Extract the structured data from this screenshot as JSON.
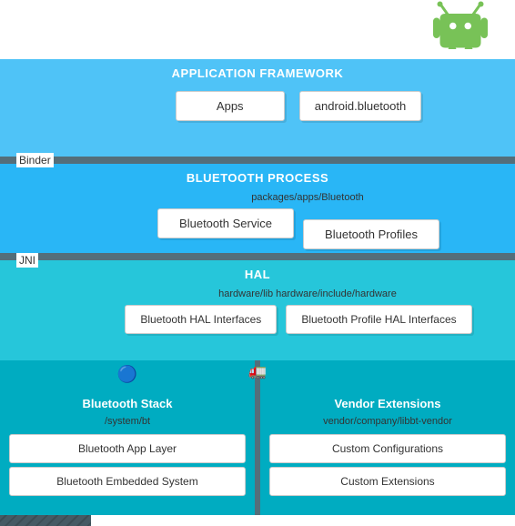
{
  "android_logo": {
    "alt": "Android Logo"
  },
  "layers": {
    "app_framework": {
      "header": "APPLICATION FRAMEWORK",
      "boxes": [
        "Apps",
        "android.bluetooth"
      ]
    },
    "binder_label": "Binder",
    "bt_process": {
      "header": "BLUETOOTH PROCESS",
      "sub_label": "packages/apps/Bluetooth",
      "boxes": [
        "Bluetooth Service",
        "Bluetooth Profiles"
      ]
    },
    "jni_label": "JNI",
    "hal": {
      "header": "HAL",
      "sub_label": "hardware/lib hardware/include/hardware",
      "boxes": [
        "Bluetooth HAL Interfaces",
        "Bluetooth Profile HAL Interfaces"
      ]
    },
    "bottom": {
      "left": {
        "header": "Bluetooth Stack",
        "sub_label": "/system/bt",
        "boxes": [
          "Bluetooth App Layer",
          "Bluetooth Embedded System"
        ]
      },
      "right": {
        "header": "Vendor Extensions",
        "sub_label": "vendor/company/libbt-vendor",
        "boxes": [
          "Custom Configurations",
          "Custom Extensions"
        ]
      }
    }
  },
  "dividers": {
    "binder": "Binder",
    "jni": "JNI"
  }
}
